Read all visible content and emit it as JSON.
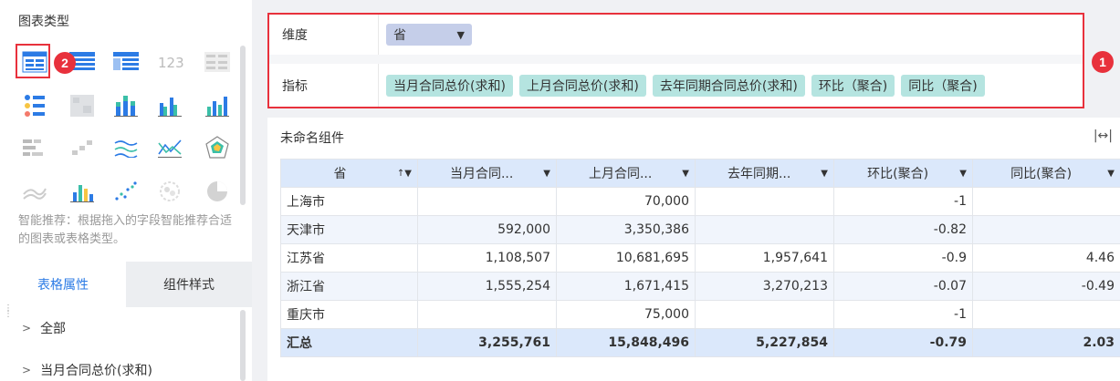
{
  "left_panel": {
    "title": "图表类型",
    "icons": [
      "table-icon",
      "detail-table-icon",
      "group-table-icon",
      "kpi-number-icon",
      "text-grid-icon",
      "dot-matrix-icon",
      "heatmap-icon",
      "stacked-bar-icon",
      "grouped-bar-icon",
      "column-chart-icon",
      "gantt-icon",
      "step-icon",
      "multi-line-icon",
      "polyline-icon",
      "radar-icon",
      "area-icon",
      "bar-line-icon",
      "scatter-icon",
      "bubble-icon",
      "pie-icon"
    ],
    "badge_2": "2",
    "hint": "智能推荐：根据拖入的字段智能推荐合适的图表或表格类型。",
    "tabs": {
      "table_props": "表格属性",
      "component_style": "组件样式"
    },
    "tree": [
      "全部",
      "当月合同总价(求和)"
    ]
  },
  "fields": {
    "dimension_label": "维度",
    "dimension_pill": "省",
    "metric_label": "指标",
    "metric_pills": [
      "当月合同总价(求和)",
      "上月合同总价(求和)",
      "去年同期合同总价(求和)",
      "环比（聚合)",
      "同比（聚合)"
    ],
    "badge_1": "1"
  },
  "widget": {
    "title": "未命名组件",
    "columns": [
      "省",
      "当月合同...",
      "上月合同...",
      "去年同期...",
      "环比(聚合)",
      "同比(聚合)"
    ],
    "rows": [
      [
        "上海市",
        "",
        "70,000",
        "",
        "-1",
        ""
      ],
      [
        "天津市",
        "592,000",
        "3,350,386",
        "",
        "-0.82",
        ""
      ],
      [
        "江苏省",
        "1,108,507",
        "10,681,695",
        "1,957,641",
        "-0.9",
        "4.46"
      ],
      [
        "浙江省",
        "1,555,254",
        "1,671,415",
        "3,270,213",
        "-0.07",
        "-0.49"
      ],
      [
        "重庆市",
        "",
        "75,000",
        "",
        "-1",
        ""
      ]
    ],
    "total": [
      "汇总",
      "3,255,761",
      "15,848,496",
      "5,227,854",
      "-0.79",
      "2.03"
    ]
  },
  "colors": {
    "accent": "#2c7be5",
    "highlight": "#e8313c",
    "dim_pill": "#c5cee9",
    "metric_pill": "#b5e4e0",
    "header_bg": "#dbe8fb"
  }
}
